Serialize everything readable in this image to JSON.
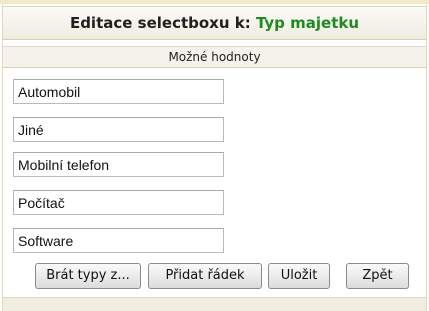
{
  "header": {
    "title_prefix": "Editace selectboxu k: ",
    "title_value": "Typ majetku",
    "title_value_color": "#1f8a1f"
  },
  "subheader": {
    "label": "Možné hodnoty"
  },
  "values": [
    "Automobil",
    "Jiné",
    "Mobilní telefon",
    "Počítač",
    "Software"
  ],
  "buttons": {
    "import_types": "Brát typy z...",
    "add_row": "Přidat řádek",
    "save": "Uložit",
    "back": "Zpět"
  }
}
